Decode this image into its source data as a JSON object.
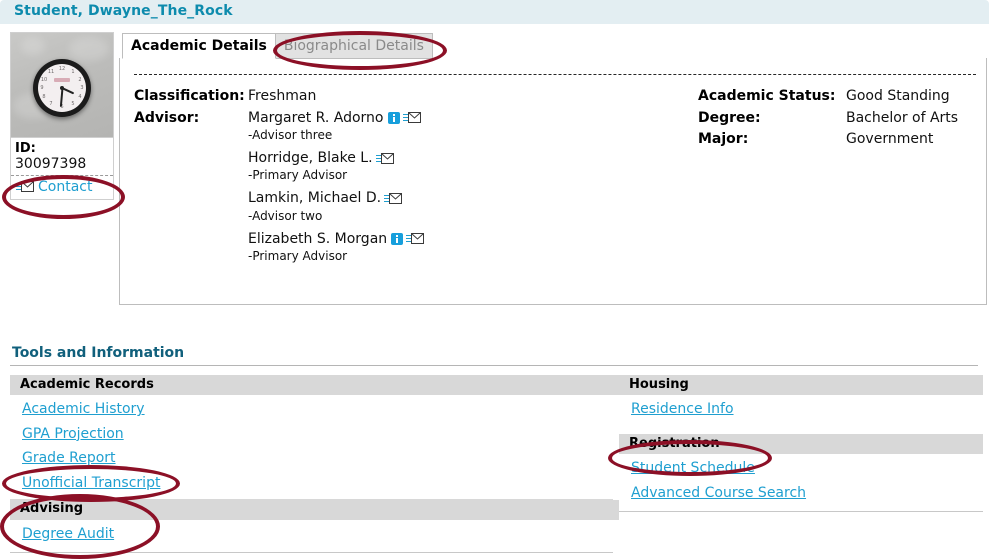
{
  "header": {
    "title": "Student, Dwayne_The_Rock"
  },
  "photo_card": {
    "photo_alt": "student-photo-clock",
    "id_label": "ID:",
    "id_value": "30097398",
    "contact_label": "Contact",
    "contact_icon": "envelope-icon"
  },
  "tabs": [
    {
      "label": "Academic Details",
      "active": true
    },
    {
      "label": "Biographical Details",
      "active": false
    }
  ],
  "details": {
    "left": {
      "classification_label": "Classification:",
      "classification_value": "Freshman",
      "advisor_label": "Advisor:",
      "advisors": [
        {
          "name": "Margaret R. Adorno",
          "role": "-Advisor three",
          "has_info_icon": true,
          "has_mail_icon": true
        },
        {
          "name": "Horridge, Blake L.",
          "role": "-Primary Advisor",
          "has_info_icon": false,
          "has_mail_icon": true
        },
        {
          "name": "Lamkin, Michael D.",
          "role": "-Advisor two",
          "has_info_icon": false,
          "has_mail_icon": true
        },
        {
          "name": "Elizabeth S. Morgan",
          "role": "-Primary Advisor",
          "has_info_icon": true,
          "has_mail_icon": true
        }
      ]
    },
    "right": {
      "status_label": "Academic Status:",
      "status_value": "Good Standing",
      "degree_label": "Degree:",
      "degree_value": "Bachelor of Arts",
      "major_label": "Major:",
      "major_value": "Government"
    }
  },
  "tools": {
    "title": "Tools and Information",
    "left_sections": [
      {
        "heading": "Academic Records",
        "links": [
          "Academic History",
          "GPA Projection",
          "Grade Report",
          "Unofficial Transcript"
        ]
      },
      {
        "heading": "Advising",
        "links": [
          "Degree Audit"
        ]
      }
    ],
    "right_sections": [
      {
        "heading": "Housing",
        "links": [
          "Residence Info"
        ]
      },
      {
        "heading": "Registration",
        "links": [
          "Student Schedule",
          "Advanced Course Search"
        ]
      }
    ]
  },
  "annotations": {
    "color": "#8c1026",
    "targets": [
      "Biographical Details tab",
      "Contact link",
      "Unofficial Transcript link",
      "Advising / Degree Audit section",
      "Student Schedule link"
    ]
  },
  "colors": {
    "header_bar": "#e3eef2",
    "header_text": "#0d8bad",
    "link": "#1f9fd0",
    "section_heading_bg": "#d8d8d8",
    "annotation": "#8c1026",
    "tools_title": "#11607c"
  }
}
